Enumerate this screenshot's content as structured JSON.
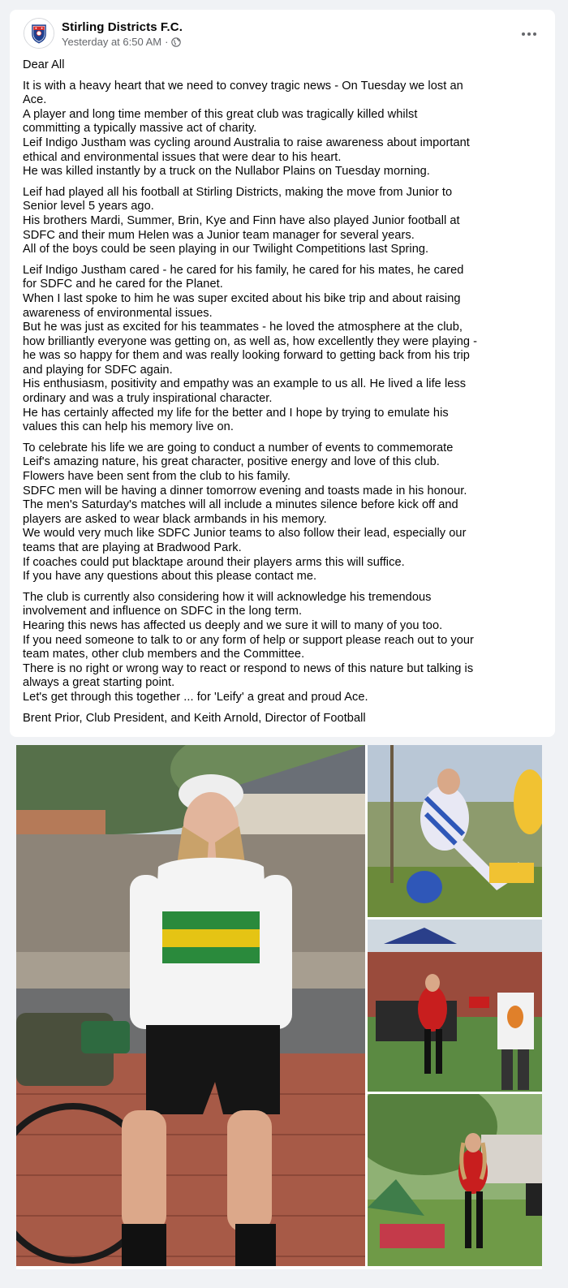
{
  "post": {
    "page_name": "Stirling Districts F.C.",
    "timestamp": "Yesterday at 6:50 AM",
    "separator": "·",
    "audience_icon": "globe-icon",
    "more_icon": "more-options-icon",
    "paragraphs": [
      [
        "Dear All"
      ],
      [
        "It is with a heavy heart that we need to convey tragic news - On Tuesday we lost an",
        "Ace.",
        "A player and long time member of this great club was tragically killed whilst",
        "committing a typically massive act of charity.",
        "Leif Indigo Justham was cycling around Australia to raise awareness about important",
        "ethical and environmental issues that were dear to his heart.",
        "He was killed instantly by a truck on the Nullabor Plains on Tuesday morning."
      ],
      [
        "Leif had played all his football at Stirling Districts, making the move from Junior to",
        "Senior level 5 years ago.",
        "His brothers Mardi, Summer, Brin, Kye and Finn have also played Junior football at",
        "SDFC and their mum Helen was a Junior team manager for several years.",
        "All of the boys could be seen playing in our Twilight Competitions last Spring."
      ],
      [
        "Leif Indigo Justham cared - he cared for his family, he cared for his mates, he cared",
        "for SDFC and he cared for the Planet.",
        "When I last spoke to him he was super excited about his bike trip and about raising",
        "awareness of environmental issues.",
        "But he was just as excited for his teammates - he loved the atmosphere at the club,",
        "how brilliantly everyone was getting on, as well as, how excellently they were playing -",
        "he was so happy for them and was really looking forward to getting back from his trip",
        "and playing for SDFC again.",
        "His enthusiasm, positivity and empathy was an example to us all. He lived a life less",
        "ordinary and was a truly inspirational character.",
        "He has certainly affected my life for the better and I hope by trying to emulate his",
        "values this can help his memory live on."
      ],
      [
        "To celebrate his life we are going to conduct a number of events to commemorate",
        "Leif's amazing nature, his great character, positive energy and love of this club.",
        "Flowers have been sent from the club to his family.",
        "SDFC men will be having a dinner tomorrow evening and toasts made in his honour.",
        "The men's Saturday's matches will all include a minutes silence before kick off and",
        "players are asked to wear black armbands in his memory.",
        "We would very much like SDFC Junior teams to also follow their lead, especially our",
        "teams that are playing at Bradwood Park.",
        "If coaches could put blacktape around their players arms this will suffice.",
        "If you have any questions about this please contact me."
      ],
      [
        "The club is currently also considering how it will acknowledge his tremendous",
        "involvement and influence on SDFC in the long term.",
        "Hearing this news has affected us deeply and we sure it will to many of you too.",
        "If you need someone to talk to or any form of help or support please reach out to your",
        "team mates, other club members and the Committee.",
        "There is no right or wrong way to react or respond to news of this nature but talking is",
        "always a great starting point.",
        "Let's get through this together ... for 'Leify' a great and proud Ace."
      ],
      [
        "Brent Prior, Club President, and Keith Arnold, Director of Football"
      ]
    ]
  },
  "photos": [
    {
      "name": "photo-cyclist",
      "description": "cyclist-with-bike"
    },
    {
      "name": "photo-football-kick",
      "description": "football-player"
    },
    {
      "name": "photo-party-dance",
      "description": "people-at-party"
    },
    {
      "name": "photo-garden-tents",
      "description": "person-in-garden"
    }
  ],
  "colors": {
    "background": "#f0f2f5",
    "card": "#ffffff",
    "text": "#050505",
    "secondary_text": "#65676b"
  }
}
